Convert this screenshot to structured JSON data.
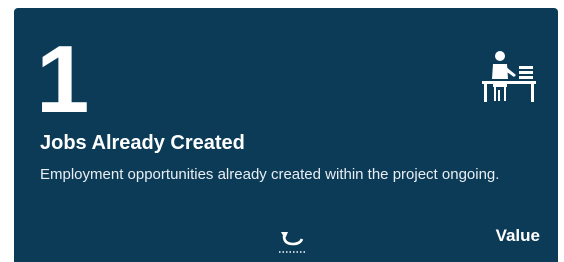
{
  "card": {
    "number": "1",
    "title": "Jobs Already Created",
    "description": "Employment opportunities already created within the project ongoing.",
    "icon": "worker-at-desk-icon",
    "background_color": "#0b3b57",
    "text_color": "#ffffff"
  },
  "footer": {
    "flip_icon": "flip-arrow-icon",
    "value_label": "Value"
  }
}
